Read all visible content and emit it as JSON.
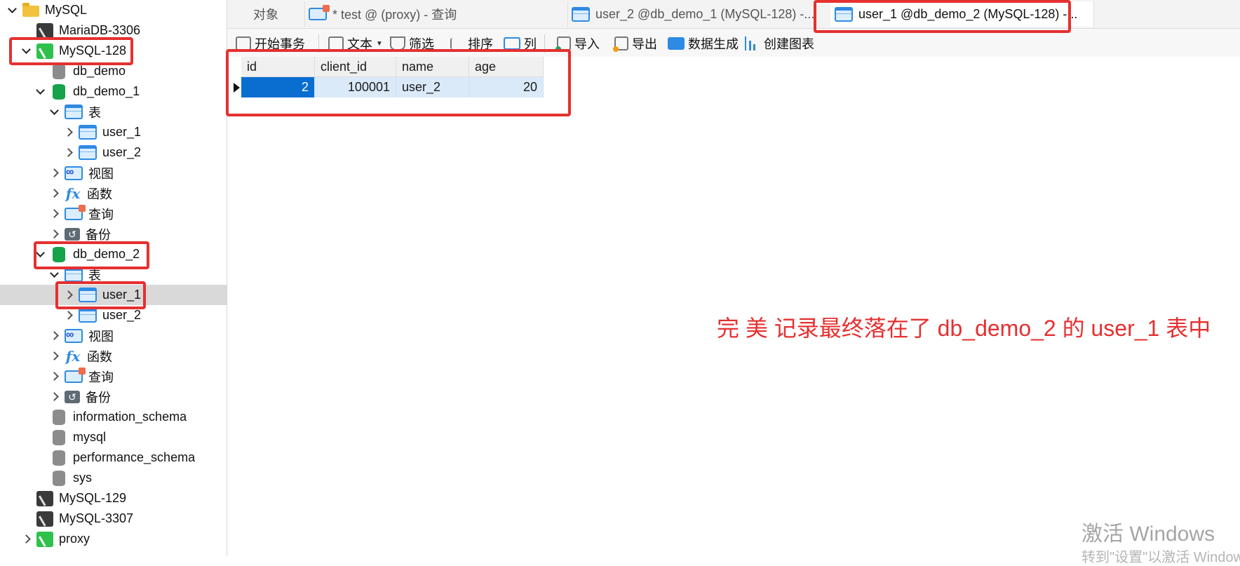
{
  "tree": [
    {
      "label": "MySQL",
      "icon": "folder-icon",
      "chev": "open",
      "indent": 0,
      "name": "tree-item-mysql-group"
    },
    {
      "label": "MariaDB-3306",
      "icon": "connection-icon",
      "chev": "none",
      "indent": 1,
      "name": "tree-item-mariadb-3306"
    },
    {
      "label": "MySQL-128",
      "icon": "connection-active-icon",
      "chev": "open",
      "indent": 1,
      "name": "tree-item-mysql-128"
    },
    {
      "label": "db_demo",
      "icon": "database-icon",
      "chev": "none",
      "indent": 2,
      "name": "tree-item-db-demo"
    },
    {
      "label": "db_demo_1",
      "icon": "database-open-icon",
      "chev": "open",
      "indent": 2,
      "name": "tree-item-db-demo-1"
    },
    {
      "label": "表",
      "icon": "tables-icon",
      "chev": "open",
      "indent": 3,
      "name": "tree-item-tables"
    },
    {
      "label": "user_1",
      "icon": "table-icon",
      "chev": "closed",
      "indent": 4,
      "name": "tree-item-table-user-1"
    },
    {
      "label": "user_2",
      "icon": "table-icon",
      "chev": "closed",
      "indent": 4,
      "name": "tree-item-table-user-2"
    },
    {
      "label": "视图",
      "icon": "view-icon",
      "chev": "closed",
      "indent": 3,
      "name": "tree-item-views"
    },
    {
      "label": "函数",
      "icon": "function-icon",
      "chev": "closed",
      "indent": 3,
      "name": "tree-item-functions"
    },
    {
      "label": "查询",
      "icon": "query-icon",
      "chev": "closed",
      "indent": 3,
      "name": "tree-item-queries"
    },
    {
      "label": "备份",
      "icon": "backup-icon",
      "chev": "closed",
      "indent": 3,
      "name": "tree-item-backups"
    },
    {
      "label": "db_demo_2",
      "icon": "database-open-icon",
      "chev": "open",
      "indent": 2,
      "name": "tree-item-db-demo-2"
    },
    {
      "label": "表",
      "icon": "tables-icon",
      "chev": "open",
      "indent": 3,
      "name": "tree-item-tables"
    },
    {
      "label": "user_1",
      "icon": "table-icon",
      "chev": "closed",
      "indent": 4,
      "name": "tree-item-table-user-1",
      "selected": true
    },
    {
      "label": "user_2",
      "icon": "table-icon",
      "chev": "closed",
      "indent": 4,
      "name": "tree-item-table-user-2"
    },
    {
      "label": "视图",
      "icon": "view-icon",
      "chev": "closed",
      "indent": 3,
      "name": "tree-item-views"
    },
    {
      "label": "函数",
      "icon": "function-icon",
      "chev": "closed",
      "indent": 3,
      "name": "tree-item-functions"
    },
    {
      "label": "查询",
      "icon": "query-icon",
      "chev": "closed",
      "indent": 3,
      "name": "tree-item-queries"
    },
    {
      "label": "备份",
      "icon": "backup-icon",
      "chev": "closed",
      "indent": 3,
      "name": "tree-item-backups"
    },
    {
      "label": "information_schema",
      "icon": "database-icon",
      "chev": "none",
      "indent": 2,
      "name": "tree-item-information-schema"
    },
    {
      "label": "mysql",
      "icon": "database-icon",
      "chev": "none",
      "indent": 2,
      "name": "tree-item-mysql-db"
    },
    {
      "label": "performance_schema",
      "icon": "database-icon",
      "chev": "none",
      "indent": 2,
      "name": "tree-item-performance-schema"
    },
    {
      "label": "sys",
      "icon": "database-icon",
      "chev": "none",
      "indent": 2,
      "name": "tree-item-sys"
    },
    {
      "label": "MySQL-129",
      "icon": "connection-icon",
      "chev": "none",
      "indent": 1,
      "name": "tree-item-mysql-129"
    },
    {
      "label": "MySQL-3307",
      "icon": "connection-icon",
      "chev": "none",
      "indent": 1,
      "name": "tree-item-mysql-3307"
    },
    {
      "label": "proxy",
      "icon": "connection-active-icon",
      "chev": "closed",
      "indent": 1,
      "name": "tree-item-proxy"
    }
  ],
  "tabs": {
    "objects": "对象",
    "query": "* test @ (proxy) - 查询",
    "table2": "user_2 @db_demo_1 (MySQL-128) -...",
    "table1": "user_1 @db_demo_2 (MySQL-128) -..."
  },
  "toolbar": {
    "begin_transaction": "开始事务",
    "text": "文本",
    "filter": "筛选",
    "sort": "排序",
    "columns": "列",
    "import": "导入",
    "export": "导出",
    "data_generation": "数据生成",
    "create_chart": "创建图表"
  },
  "grid": {
    "columns": [
      "id",
      "client_id",
      "name",
      "age"
    ],
    "rows": [
      {
        "id": "2",
        "client_id": "100001",
        "name": "user_2",
        "age": "20"
      }
    ]
  },
  "annotation": "完 美   记录最终落在了 db_demo_2 的 user_1 表中",
  "watermark": {
    "line1": "激活 Windows",
    "line2": "转到\"设置\"以激活 Windows。"
  },
  "colors": {
    "highlight_red": "#e53030",
    "selected_cell": "#0a6ed1",
    "row_bg": "#dbeaf9",
    "connection_active": "#2ec14b"
  }
}
